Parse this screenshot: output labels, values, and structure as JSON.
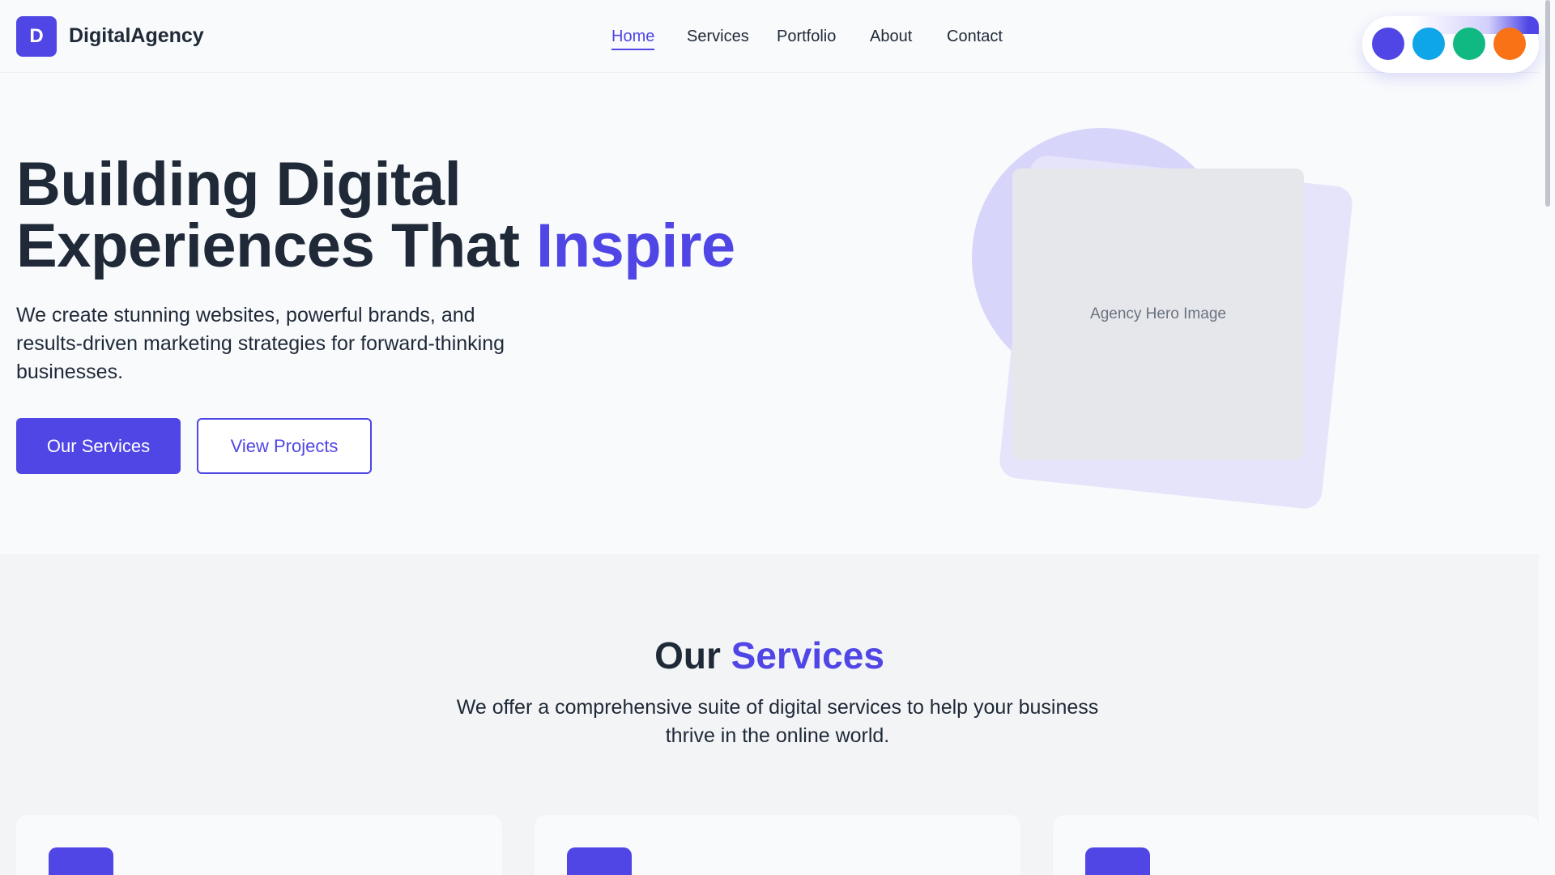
{
  "brand": {
    "initial": "D",
    "name": "DigitalAgency"
  },
  "nav": {
    "items": [
      {
        "label": "Home",
        "active": true
      },
      {
        "label": "Services",
        "active": false
      },
      {
        "label": "Portfolio",
        "active": false
      },
      {
        "label": "About",
        "active": false
      },
      {
        "label": "Contact",
        "active": false
      }
    ]
  },
  "theme_swatches": [
    "#4f46e5",
    "#0ea5e9",
    "#10b981",
    "#f97316"
  ],
  "hero": {
    "title_line1": "Building Digital",
    "title_line2_plain": "Experiences That ",
    "title_line2_accent": "Inspire",
    "subtitle": "We create stunning websites, powerful brands, and results-driven marketing strategies for forward-thinking businesses.",
    "primary_button": "Our Services",
    "secondary_button": "View Projects",
    "image_placeholder": "Agency Hero Image"
  },
  "services": {
    "title_plain": "Our ",
    "title_accent": "Services",
    "subtitle": "We offer a comprehensive suite of digital services to help your business thrive in the online world."
  },
  "colors": {
    "accent": "#4f46e5",
    "text": "#1f2937",
    "background": "#f8fafc",
    "section_bg": "#f3f4f6"
  }
}
